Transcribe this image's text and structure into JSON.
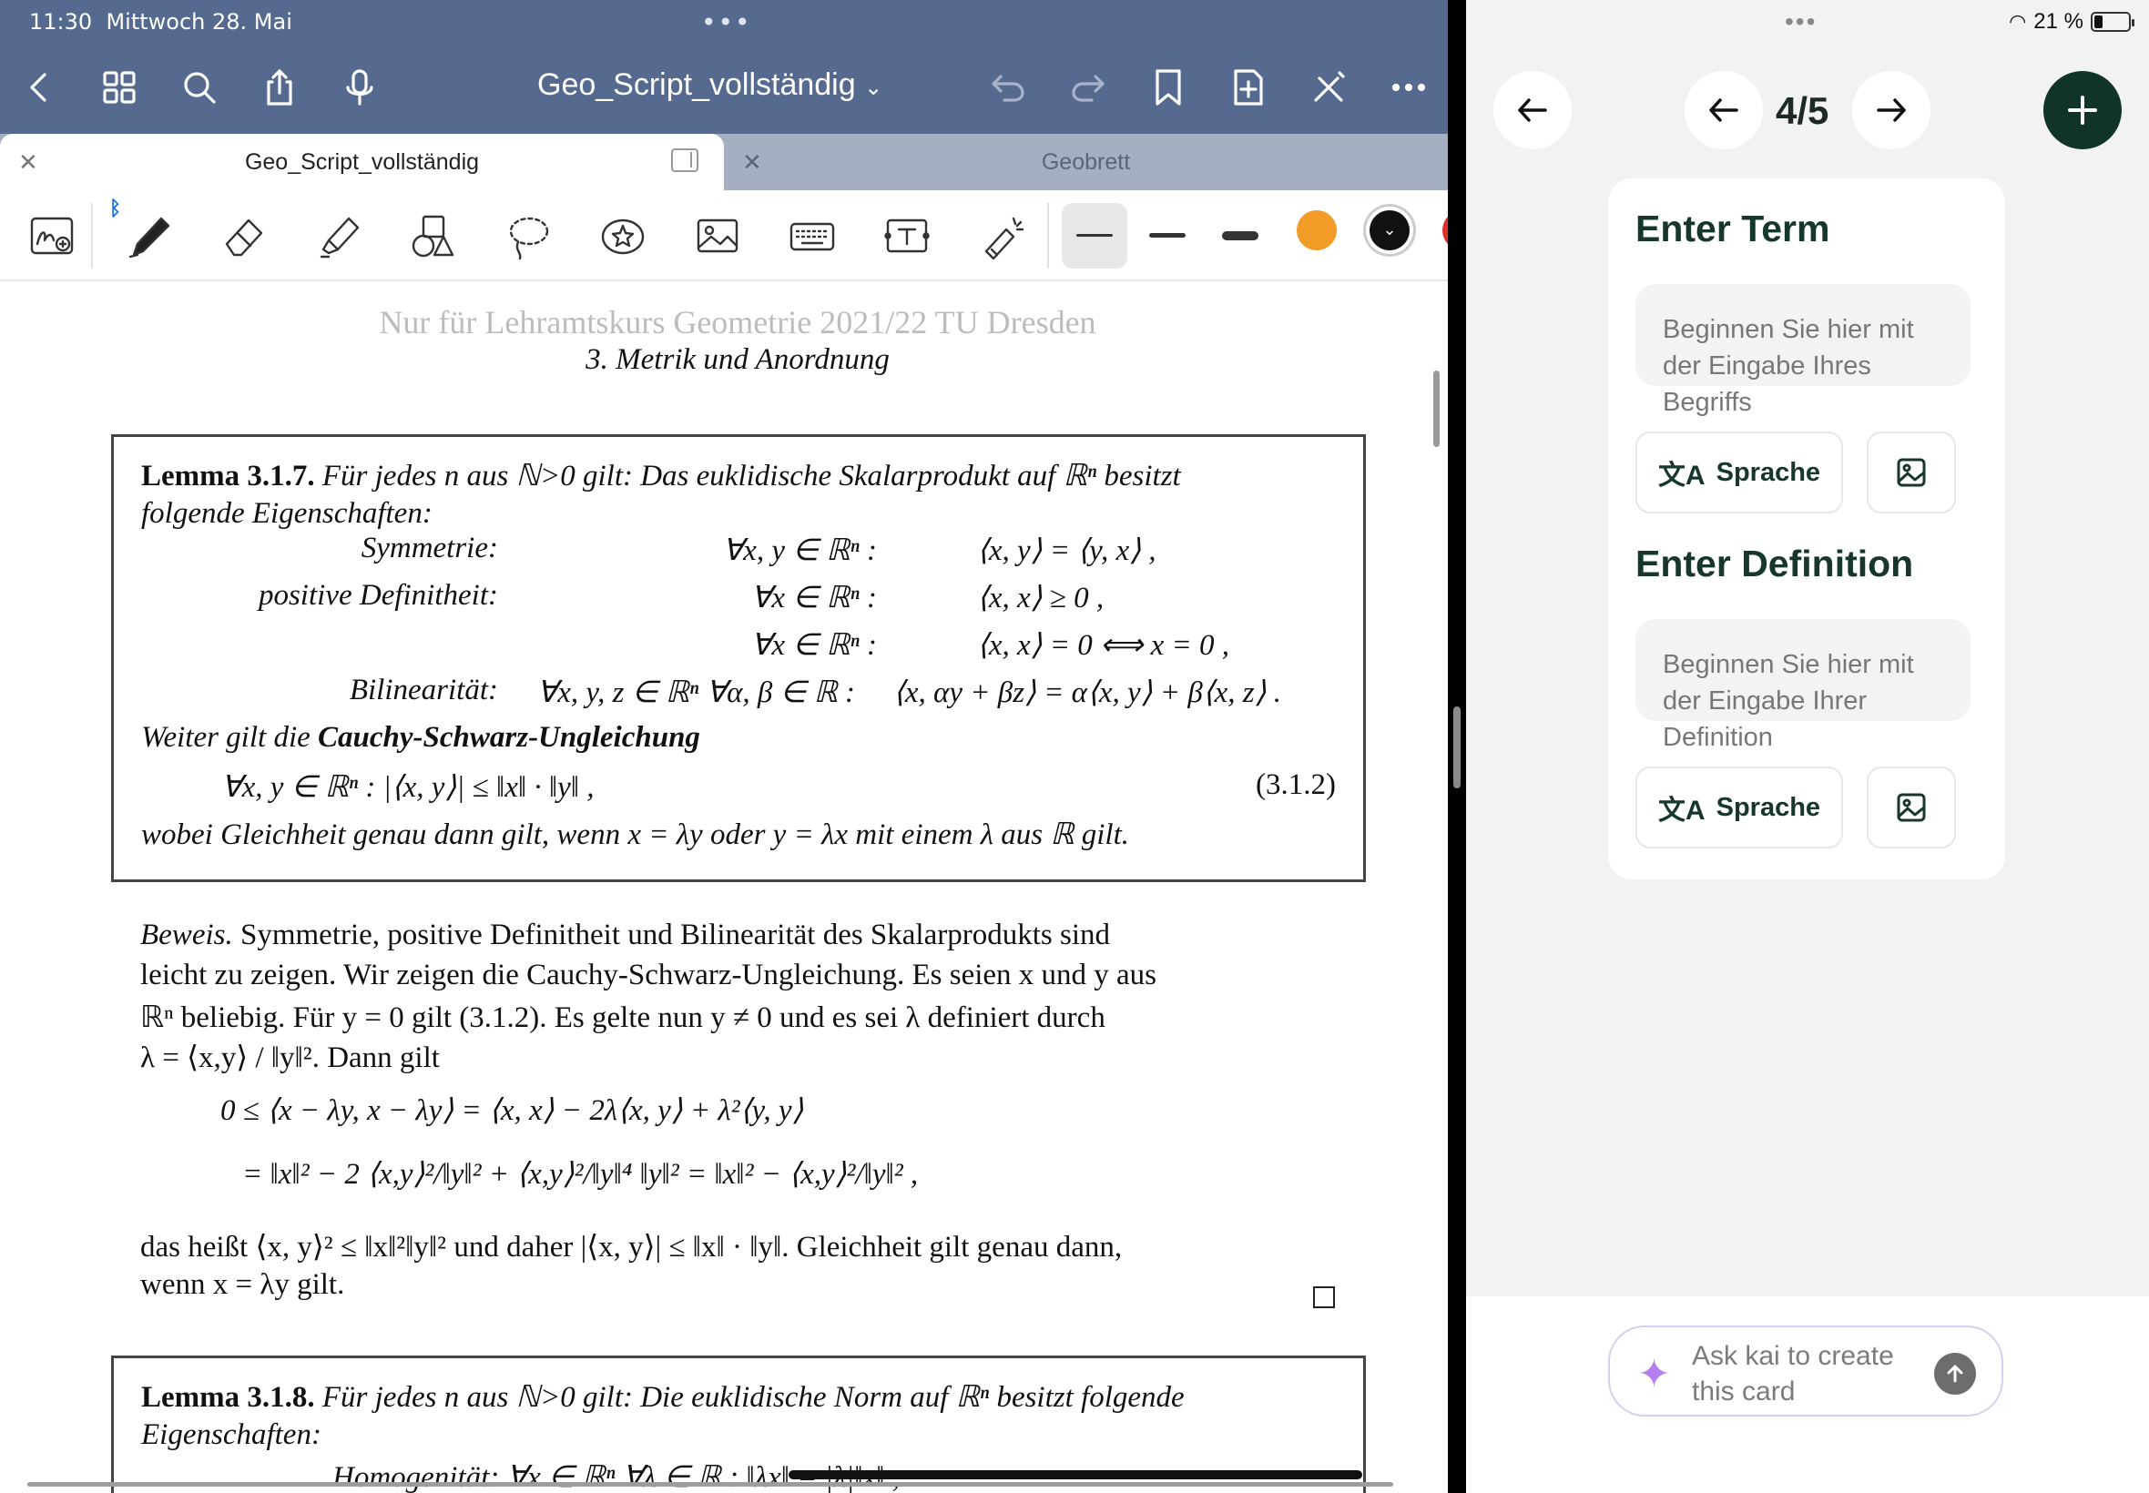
{
  "status_bar": {
    "time": "11:30",
    "date": "Mittwoch 28. Mai",
    "battery": "21 %"
  },
  "pdf_app": {
    "document_title": "Geo_Script_vollständig",
    "tabs": [
      {
        "label": "Geo_Script_vollständig",
        "active": true
      },
      {
        "label": "Geobrett",
        "active": false
      }
    ],
    "toolbar_colors": {
      "orange": "#f29b26",
      "black": "#111111",
      "red": "#e0302a"
    },
    "header_color": "#56698f"
  },
  "pdf_content": {
    "running_header": "Nur für Lehramtskurs Geometrie 2021/22 TU Dresden",
    "chapter_heading": "3.  Metrik und Anordnung",
    "lemma1": {
      "title": "Lemma 3.1.7.",
      "intro": "Für jedes n aus ℕ>0 gilt: Das euklidische Skalarprodukt auf ℝⁿ besitzt",
      "intro2": "folgende Eigenschaften:",
      "props": [
        {
          "name": "Symmetrie:",
          "quant": "∀x, y ∈ ℝⁿ :",
          "formula": "⟨x, y⟩ = ⟨y, x⟩ ,"
        },
        {
          "name": "positive Definitheit:",
          "quant": "∀x ∈ ℝⁿ :",
          "formula": "⟨x, x⟩ ≥ 0 ,"
        },
        {
          "name": "",
          "quant": "∀x ∈ ℝⁿ :",
          "formula": "⟨x, x⟩ = 0 ⟺ x = 0 ,"
        },
        {
          "name": "Bilinearität:",
          "quant": "∀x, y, z ∈ ℝⁿ ∀α, β ∈ ℝ :",
          "formula": "⟨x, αy + βz⟩ = α⟨x, y⟩ + β⟨x, z⟩ ."
        }
      ],
      "further_prefix": "Weiter gilt die ",
      "further_bold": "Cauchy-Schwarz-Ungleichung",
      "cs_formula": "∀x, y ∈ ℝⁿ :     |⟨x, y⟩| ≤ ‖x‖ · ‖y‖ ,",
      "cs_number": "(3.1.2)",
      "equality_note": "wobei Gleichheit genau dann gilt, wenn x = λy oder y = λx mit einem λ aus ℝ gilt."
    },
    "proof": {
      "label": "Beweis.",
      "line1": " Symmetrie, positive Definitheit und Bilinearität des Skalarprodukts sind",
      "line2": "leicht zu zeigen. Wir zeigen die Cauchy-Schwarz-Ungleichung. Es seien x und y aus",
      "line3": "ℝⁿ beliebig. Für y = 0 gilt (3.1.2). Es gelte nun y ≠ 0 und es sei λ definiert durch",
      "line4": "λ = ⟨x,y⟩ / ‖y‖². Dann gilt",
      "eq1": "0 ≤ ⟨x − λy, x − λy⟩ = ⟨x, x⟩ − 2λ⟨x, y⟩ + λ²⟨y, y⟩",
      "eq2": "= ‖x‖² − 2 ⟨x,y⟩²/‖y‖² + ⟨x,y⟩²/‖y‖⁴ ‖y‖² = ‖x‖² − ⟨x,y⟩²/‖y‖² ,",
      "line5": "das heißt ⟨x, y⟩² ≤ ‖x‖²‖y‖² und daher |⟨x, y⟩| ≤ ‖x‖ · ‖y‖. Gleichheit gilt genau dann,",
      "line6": "wenn x = λy gilt."
    },
    "lemma2": {
      "title": "Lemma 3.1.8.",
      "intro": "Für jedes n aus ℕ>0 gilt: Die euklidische Norm auf ℝⁿ besitzt folgende",
      "intro2": "Eigenschaften:",
      "partial": "Homogenität:          ∀x ∈ ℝⁿ ∀λ ∈ ℝ :          ‖λx‖ = |λ|‖x‖ ,"
    }
  },
  "flashcard_app": {
    "page_indicator": "4/5",
    "term_section_title": "Enter Term",
    "term_placeholder": "Beginnen Sie hier mit der Eingabe Ihres Begriffs",
    "definition_section_title": "Enter Definition",
    "definition_placeholder": "Beginnen Sie hier mit der Eingabe Ihrer Definition",
    "language_button": "Sprache",
    "ask_placeholder": "Ask kai to create this card",
    "accent_color": "#10332a"
  }
}
